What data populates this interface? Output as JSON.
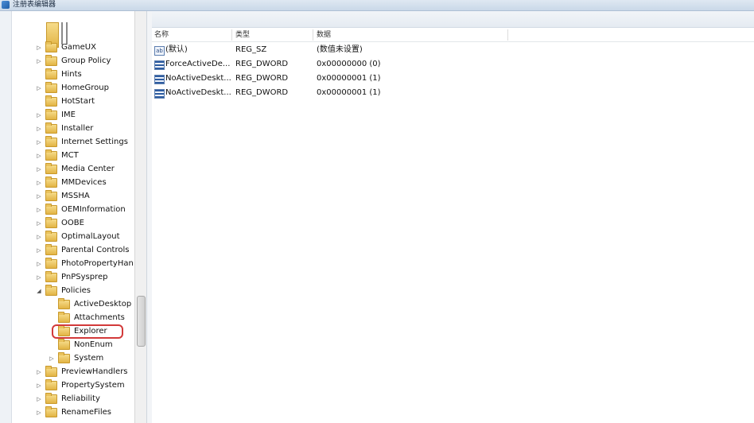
{
  "window": {
    "title": "注册表编辑器",
    "icon": "registry-editor-icon"
  },
  "tree": {
    "items": [
      {
        "label": "GameUX",
        "level": 0,
        "expander": "collapsed"
      },
      {
        "label": "Group Policy",
        "level": 0,
        "expander": "collapsed"
      },
      {
        "label": "Hints",
        "level": 0,
        "expander": "none"
      },
      {
        "label": "HomeGroup",
        "level": 0,
        "expander": "collapsed"
      },
      {
        "label": "HotStart",
        "level": 0,
        "expander": "none"
      },
      {
        "label": "IME",
        "level": 0,
        "expander": "collapsed"
      },
      {
        "label": "Installer",
        "level": 0,
        "expander": "collapsed"
      },
      {
        "label": "Internet Settings",
        "level": 0,
        "expander": "collapsed"
      },
      {
        "label": "MCT",
        "level": 0,
        "expander": "collapsed"
      },
      {
        "label": "Media Center",
        "level": 0,
        "expander": "collapsed"
      },
      {
        "label": "MMDevices",
        "level": 0,
        "expander": "collapsed"
      },
      {
        "label": "MSSHA",
        "level": 0,
        "expander": "collapsed"
      },
      {
        "label": "OEMInformation",
        "level": 0,
        "expander": "collapsed"
      },
      {
        "label": "OOBE",
        "level": 0,
        "expander": "collapsed"
      },
      {
        "label": "OptimalLayout",
        "level": 0,
        "expander": "collapsed"
      },
      {
        "label": "Parental Controls",
        "level": 0,
        "expander": "collapsed"
      },
      {
        "label": "PhotoPropertyHan",
        "level": 0,
        "expander": "collapsed"
      },
      {
        "label": "PnPSysprep",
        "level": 0,
        "expander": "collapsed"
      },
      {
        "label": "Policies",
        "level": 0,
        "expander": "expanded"
      },
      {
        "label": "ActiveDesktop",
        "level": 1,
        "expander": "none"
      },
      {
        "label": "Attachments",
        "level": 1,
        "expander": "none"
      },
      {
        "label": "Explorer",
        "level": 1,
        "expander": "none",
        "highlighted": true
      },
      {
        "label": "NonEnum",
        "level": 1,
        "expander": "none"
      },
      {
        "label": "System",
        "level": 1,
        "expander": "collapsed"
      },
      {
        "label": "PreviewHandlers",
        "level": 0,
        "expander": "collapsed"
      },
      {
        "label": "PropertySystem",
        "level": 0,
        "expander": "collapsed"
      },
      {
        "label": "Reliability",
        "level": 0,
        "expander": "collapsed"
      },
      {
        "label": "RenameFiles",
        "level": 0,
        "expander": "collapsed"
      }
    ]
  },
  "values": {
    "columns": {
      "name": "名称",
      "type": "类型",
      "data": "数据"
    },
    "rows": [
      {
        "name": "(默认)",
        "type": "REG_SZ",
        "data": "(数值未设置)",
        "icon": "string-value-icon"
      },
      {
        "name": "ForceActiveDe...",
        "type": "REG_DWORD",
        "data": "0x00000000 (0)",
        "icon": "dword-value-icon"
      },
      {
        "name": "NoActiveDeskt...",
        "type": "REG_DWORD",
        "data": "0x00000001 (1)",
        "icon": "dword-value-icon"
      },
      {
        "name": "NoActiveDeskt...",
        "type": "REG_DWORD",
        "data": "0x00000001 (1)",
        "icon": "dword-value-icon"
      }
    ]
  },
  "colors": {
    "highlight_box": "#d23a3a",
    "folder": "#e2b444"
  }
}
